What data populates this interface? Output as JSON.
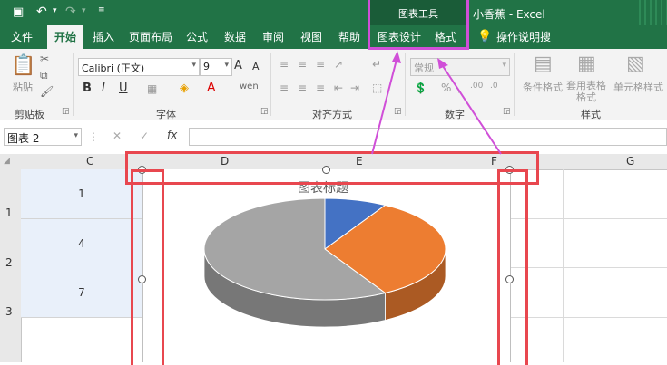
{
  "title_bar": {
    "contextual_tab_group": "图表工具",
    "window_title": "小香蕉 - Excel"
  },
  "tabs": [
    "文件",
    "开始",
    "插入",
    "页面布局",
    "公式",
    "数据",
    "审阅",
    "视图",
    "帮助",
    "图表设计",
    "格式"
  ],
  "tell_me": "操作说明搜索",
  "ribbon": {
    "paste_label": "粘贴",
    "clipboard_label": "剪贴板",
    "font_name": "Calibri (正文)",
    "font_size": "9",
    "font_group_label": "字体",
    "alignment_label": "对齐方式",
    "number_format": "常规",
    "number_label": "数字",
    "cond_format_label": "条件格式",
    "table_format_label": "套用表格格式",
    "cell_style_label": "单元格样式",
    "styles_label": "样式",
    "bold": "B",
    "italic": "I",
    "underline": "U",
    "font_grow": "A",
    "font_shrink": "A"
  },
  "formula_bar": {
    "name_box": "图表 2",
    "fx": "fx",
    "cancel": "✕",
    "enter": "✓"
  },
  "columns": [
    "C",
    "D",
    "E",
    "F",
    "G"
  ],
  "rows": [
    "1",
    "2",
    "3"
  ],
  "cells": [
    "1",
    "4",
    "7"
  ],
  "chart": {
    "title": "图表标题"
  },
  "chart_data": {
    "type": "pie",
    "title": "图表标题",
    "values": [
      1,
      4,
      7
    ],
    "colors": [
      "#4472c4",
      "#ed7d31",
      "#a5a5a5"
    ]
  }
}
